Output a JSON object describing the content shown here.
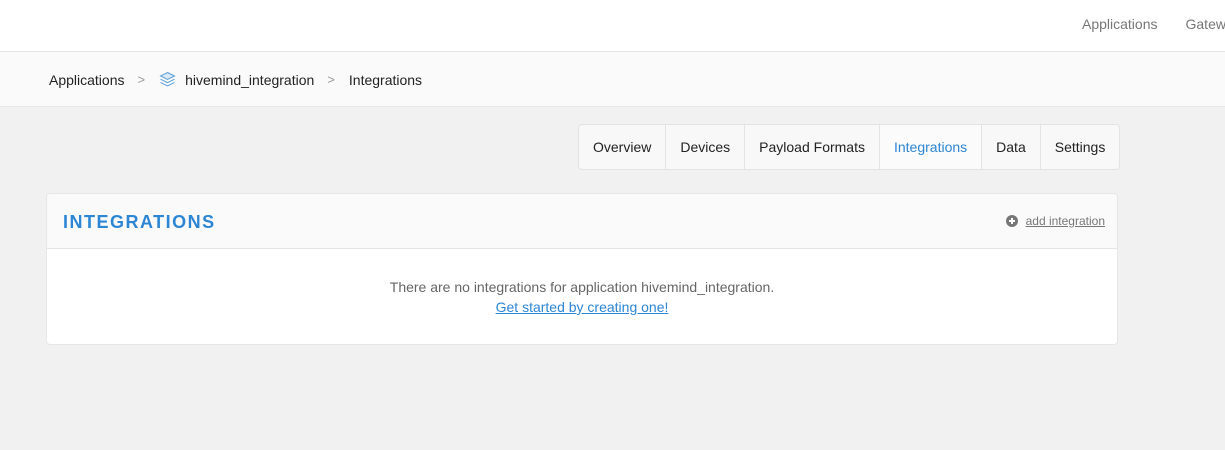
{
  "topnav": {
    "links": [
      "Applications",
      "Gatew"
    ]
  },
  "breadcrumb": {
    "items": [
      "Applications",
      "hivemind_integration",
      "Integrations"
    ],
    "separator": ">"
  },
  "tabs": [
    {
      "label": "Overview",
      "active": false
    },
    {
      "label": "Devices",
      "active": false
    },
    {
      "label": "Payload Formats",
      "active": false
    },
    {
      "label": "Integrations",
      "active": true
    },
    {
      "label": "Data",
      "active": false
    },
    {
      "label": "Settings",
      "active": false
    }
  ],
  "card": {
    "title": "INTEGRATIONS",
    "add_label": "add integration",
    "empty_message": "There are no integrations for application hivemind_integration.",
    "empty_cta": "Get started by creating one!"
  },
  "colors": {
    "accent": "#2c86d4",
    "muted": "#777777"
  },
  "icons": {
    "app": "layers-icon",
    "add": "plus-circle-icon"
  }
}
